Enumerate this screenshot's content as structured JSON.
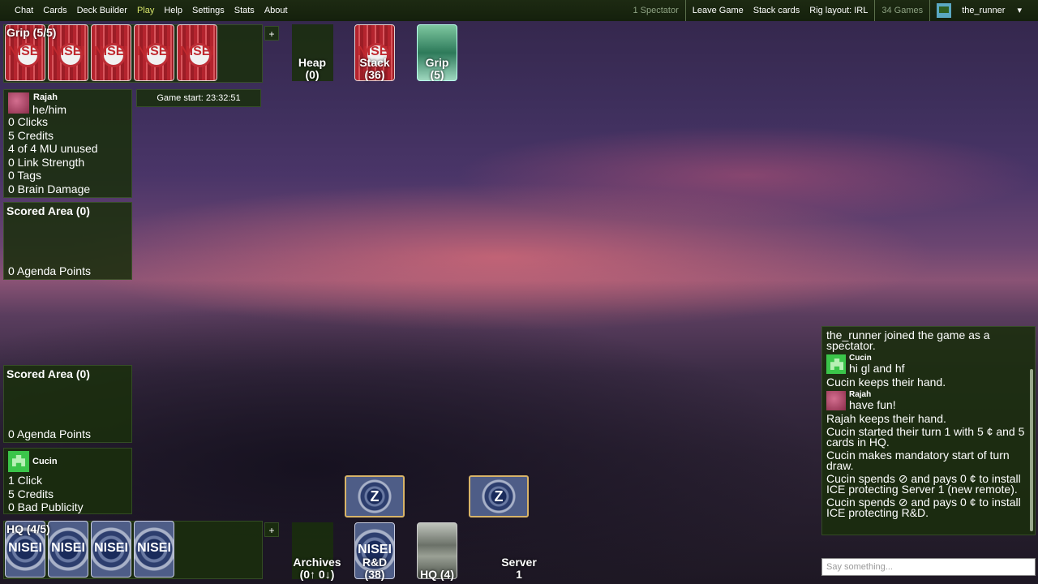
{
  "nav": {
    "left": [
      "Chat",
      "Cards",
      "Deck Builder",
      "Play",
      "Help",
      "Settings",
      "Stats",
      "About"
    ],
    "active": "Play",
    "spectators": "1 Spectator",
    "leave": "Leave Game",
    "stack_cards": "Stack cards",
    "rig_layout": "Rig layout: IRL",
    "games": "34 Games",
    "username": "the_runner",
    "dropdown": "▾"
  },
  "runner": {
    "grip_title": "Grip (5/5)",
    "plus": "+",
    "heap": "Heap\n(0)",
    "stack": "Stack\n(36)",
    "grip_pile": "Grip\n(5)",
    "card_logo": "NISEI",
    "name": "Rajah",
    "pronouns": "he/him",
    "clicks": "0 Clicks",
    "credits": "5 Credits",
    "mu": "4 of 4 MU unused",
    "link": "0 Link Strength",
    "tags": "0 Tags",
    "brain": "0 Brain Damage",
    "scored_title": "Scored Area (0)",
    "agenda": "0 Agenda Points"
  },
  "game_start": "Game start: 23:32:51",
  "corp": {
    "scored_title": "Scored Area (0)",
    "agenda": "0 Agenda Points",
    "name": "Cucin",
    "clicks": "1 Click",
    "credits": "5 Credits",
    "bad_pub": "0 Bad Publicity",
    "hq_title": "HQ (4/5)",
    "plus": "+",
    "archives": "Archives\n(0↑ 0↓)",
    "rd": "R&D\n(38)",
    "hq_pile": "HQ (4)",
    "server": "Server\n1",
    "card_logo": "NISEI"
  },
  "chat": {
    "messages": [
      {
        "type": "system",
        "text": "the_runner joined the game as a spectator."
      },
      {
        "type": "user",
        "user": "Cucin",
        "text": "hi gl and hf"
      },
      {
        "type": "system",
        "text": "Cucin keeps their hand."
      },
      {
        "type": "user",
        "user": "Rajah",
        "text": "have fun!"
      },
      {
        "type": "system",
        "text": "Rajah keeps their hand."
      },
      {
        "type": "system",
        "text": "Cucin started their turn 1 with 5 ¢ and 5 cards in HQ."
      },
      {
        "type": "system",
        "text": "Cucin makes mandatory start of turn draw."
      },
      {
        "type": "system",
        "text": "Cucin spends ⊘ and pays 0 ¢ to install ICE protecting Server 1 (new remote)."
      },
      {
        "type": "system",
        "text": "Cucin spends ⊘ and pays 0 ¢ to install ICE protecting R&D."
      }
    ],
    "placeholder": "Say something..."
  }
}
